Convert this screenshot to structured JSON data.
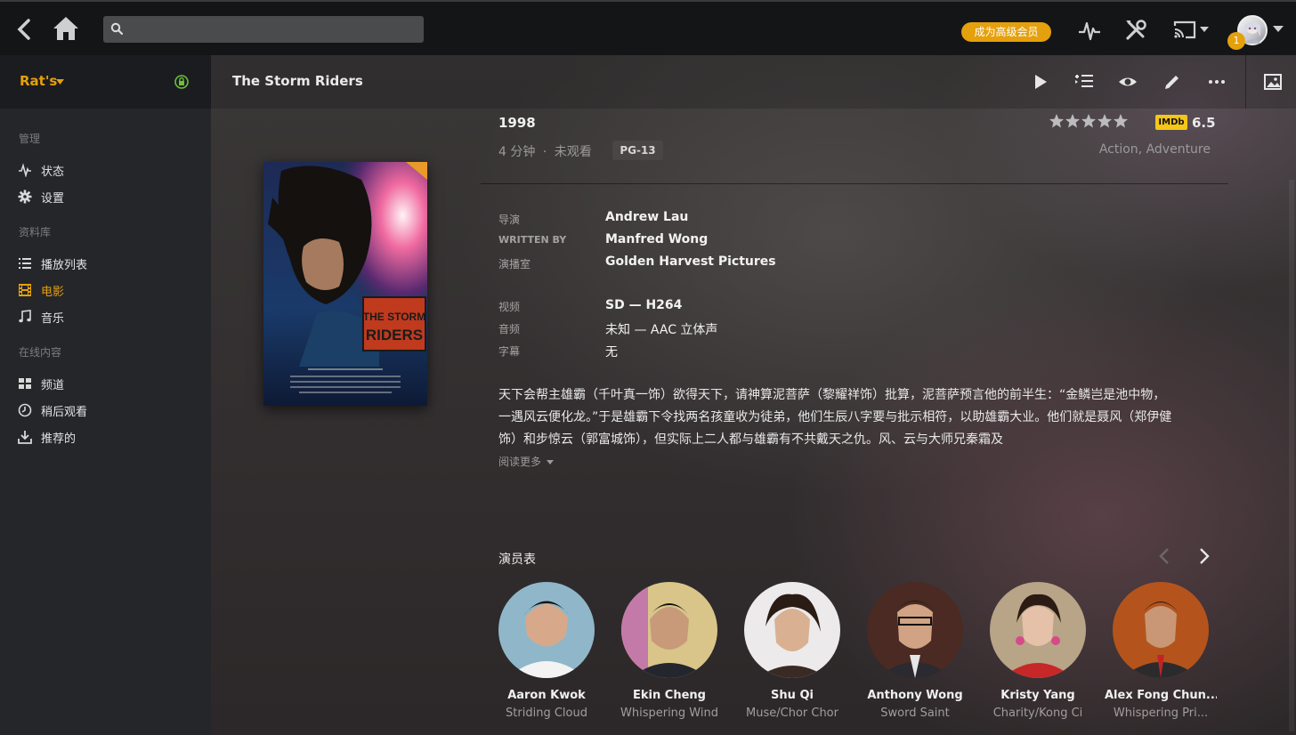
{
  "topbar": {
    "search_placeholder": "",
    "premium_label": "成为高级会员",
    "notification_count": "1",
    "accent": "#e5a00d"
  },
  "sidebar": {
    "server_name": "Rat's",
    "sections": [
      {
        "label": "管理",
        "items": [
          {
            "label": "状态",
            "icon": "activity-icon"
          },
          {
            "label": "设置",
            "icon": "gear-icon"
          }
        ]
      },
      {
        "label": "资料库",
        "items": [
          {
            "label": "播放列表",
            "icon": "list-icon"
          },
          {
            "label": "电影",
            "icon": "film-icon",
            "active": true
          },
          {
            "label": "音乐",
            "icon": "music-note-icon"
          }
        ]
      },
      {
        "label": "在线内容",
        "items": [
          {
            "label": "频道",
            "icon": "grid-icon"
          },
          {
            "label": "稍后观看",
            "icon": "clock-icon"
          },
          {
            "label": "推荐的",
            "icon": "download-icon"
          }
        ]
      }
    ]
  },
  "movie": {
    "title": "The Storm Riders",
    "year": "1998",
    "duration": "4 分钟",
    "separator": "·",
    "watch_status": "未观看",
    "content_rating": "PG-13",
    "imdb_label": "IMDb",
    "imdb_score": "6.5",
    "genres": "Action, Adventure",
    "poster_title_line1": "THE STORM",
    "poster_title_line2": "RIDERS",
    "details": [
      {
        "label": "导演",
        "value": "Andrew Lau"
      },
      {
        "label": "WRITTEN BY",
        "value": "Manfred Wong"
      },
      {
        "label": "演播室",
        "value": "Golden Harvest Pictures"
      }
    ],
    "media": [
      {
        "label": "视频",
        "value": "SD — H264"
      },
      {
        "label": "音频",
        "value": "未知 — AAC 立体声"
      },
      {
        "label": "字幕",
        "value": "无"
      }
    ],
    "summary": "天下会帮主雄霸（千叶真一饰）欲得天下，请神算泥菩萨（黎耀祥饰）批算，泥菩萨预言他的前半生：“金鳞岂是池中物，一遇风云便化龙。”于是雄霸下令找两名孩童收为徒弟，他们生辰八字要与批示相符，以助雄霸大业。他们就是聂风（郑伊健饰）和步惊云（郭富城饰），但实际上二人都与雄霸有不共戴天之仇。风、云与大师兄秦霜及",
    "read_more": "阅读更多"
  },
  "cast": {
    "title": "演员表",
    "members": [
      {
        "name": "Aaron Kwok",
        "role": "Striding Cloud"
      },
      {
        "name": "Ekin Cheng",
        "role": "Whispering Wind"
      },
      {
        "name": "Shu Qi",
        "role": "Muse/Chor Chor"
      },
      {
        "name": "Anthony Wong",
        "role": "Sword Saint"
      },
      {
        "name": "Kristy Yang",
        "role": "Charity/Kong Ci"
      },
      {
        "name": "Alex Fong Chun...",
        "role": "Whispering Pri..."
      }
    ]
  }
}
